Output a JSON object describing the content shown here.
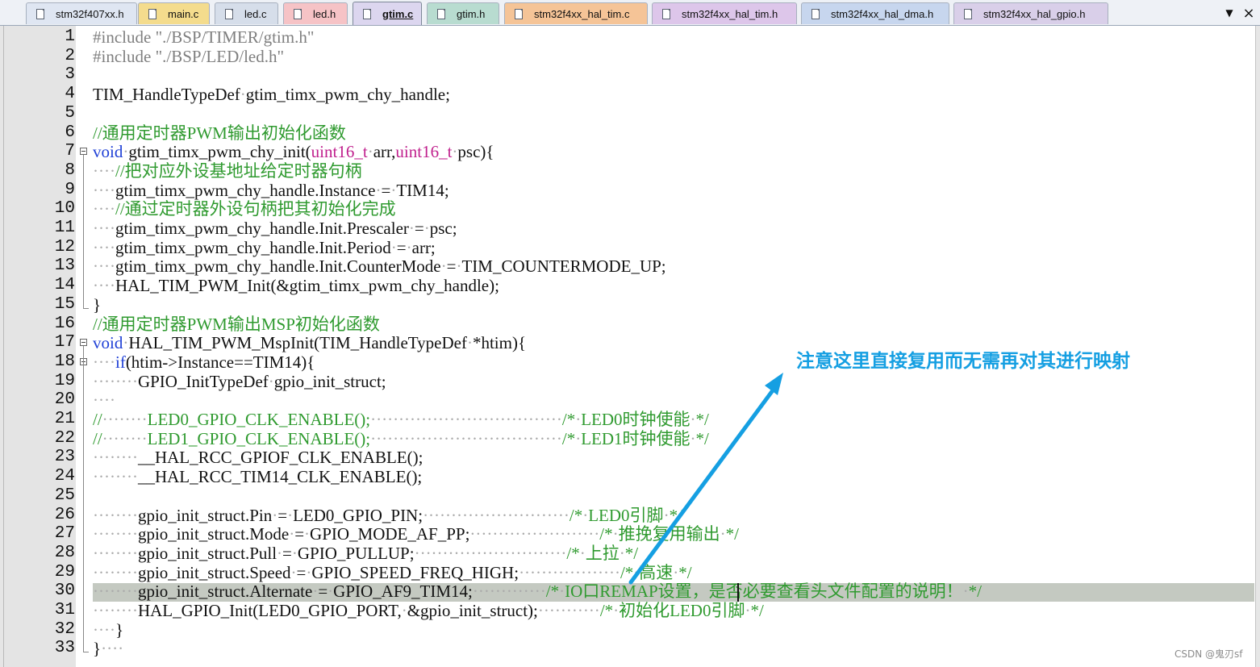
{
  "tabs": [
    {
      "label": "stm32f407xx.h",
      "color": "#dfe6f2",
      "active": false
    },
    {
      "label": "main.c",
      "color": "#f4dc8d",
      "active": false
    },
    {
      "label": "led.c",
      "color": "#d6deea",
      "active": false
    },
    {
      "label": "led.h",
      "color": "#f6c3c6",
      "active": false
    },
    {
      "label": "gtim.c",
      "color": "#dcd6ef",
      "active": true
    },
    {
      "label": "gtim.h",
      "color": "#b8dcd0",
      "active": false
    },
    {
      "label": "stm32f4xx_hal_tim.c",
      "color": "#f5c497",
      "active": false
    },
    {
      "label": "stm32f4xx_hal_tim.h",
      "color": "#ddc6ea",
      "active": false
    },
    {
      "label": "stm32f4xx_hal_dma.h",
      "color": "#c7d6ee",
      "active": false
    },
    {
      "label": "stm32f4xx_hal_gpio.h",
      "color": "#d9cfe9",
      "active": false
    }
  ],
  "tab_menu_glyph": "▼",
  "tab_close_glyph": "×",
  "line_numbers": [
    "1",
    "2",
    "3",
    "4",
    "5",
    "6",
    "7",
    "8",
    "9",
    "10",
    "11",
    "12",
    "13",
    "14",
    "15",
    "16",
    "17",
    "18",
    "19",
    "20",
    "21",
    "22",
    "23",
    "24",
    "25",
    "26",
    "27",
    "28",
    "29",
    "30",
    "31",
    "32",
    "33"
  ],
  "code": [
    [
      {
        "t": "#include ",
        "c": "c-pre"
      },
      {
        "t": "\"./BSP/TIMER/gtim.h\"",
        "c": "c-str"
      }
    ],
    [
      {
        "t": "#include ",
        "c": "c-pre"
      },
      {
        "t": "\"./BSP/LED/led.h\"",
        "c": "c-str"
      }
    ],
    [],
    [
      {
        "t": "TIM_HandleTypeDef",
        "c": ""
      },
      {
        "t": "·",
        "c": "c-dot"
      },
      {
        "t": "gtim_timx_pwm_chy_handle;",
        "c": ""
      }
    ],
    [],
    [
      {
        "t": "//通用定时器PWM输出初始化函数",
        "c": "c-com"
      }
    ],
    [
      {
        "t": "void",
        "c": "c-kw"
      },
      {
        "t": "·",
        "c": "c-dot"
      },
      {
        "t": "gtim_timx_pwm_chy_init(",
        "c": ""
      },
      {
        "t": "uint16_t",
        "c": "c-typ"
      },
      {
        "t": "·",
        "c": "c-dot"
      },
      {
        "t": "arr,",
        "c": ""
      },
      {
        "t": "uint16_t",
        "c": "c-typ"
      },
      {
        "t": "·",
        "c": "c-dot"
      },
      {
        "t": "psc){",
        "c": ""
      }
    ],
    [
      {
        "t": "····",
        "c": "c-dot"
      },
      {
        "t": "//把对应外设基地址给定时器句柄",
        "c": "c-com"
      }
    ],
    [
      {
        "t": "····",
        "c": "c-dot"
      },
      {
        "t": "gtim_timx_pwm_chy_handle.Instance",
        "c": ""
      },
      {
        "t": "·",
        "c": "c-dot"
      },
      {
        "t": "=",
        "c": ""
      },
      {
        "t": "·",
        "c": "c-dot"
      },
      {
        "t": "TIM14;",
        "c": ""
      }
    ],
    [
      {
        "t": "····",
        "c": "c-dot"
      },
      {
        "t": "//通过定时器外设句柄把其初始化完成",
        "c": "c-com"
      }
    ],
    [
      {
        "t": "····",
        "c": "c-dot"
      },
      {
        "t": "gtim_timx_pwm_chy_handle.Init.Prescaler",
        "c": ""
      },
      {
        "t": "·",
        "c": "c-dot"
      },
      {
        "t": "=",
        "c": ""
      },
      {
        "t": "·",
        "c": "c-dot"
      },
      {
        "t": "psc;",
        "c": ""
      }
    ],
    [
      {
        "t": "····",
        "c": "c-dot"
      },
      {
        "t": "gtim_timx_pwm_chy_handle.Init.Period",
        "c": ""
      },
      {
        "t": "·",
        "c": "c-dot"
      },
      {
        "t": "=",
        "c": ""
      },
      {
        "t": "·",
        "c": "c-dot"
      },
      {
        "t": "arr;",
        "c": ""
      }
    ],
    [
      {
        "t": "····",
        "c": "c-dot"
      },
      {
        "t": "gtim_timx_pwm_chy_handle.Init.CounterMode",
        "c": ""
      },
      {
        "t": "·",
        "c": "c-dot"
      },
      {
        "t": "=",
        "c": ""
      },
      {
        "t": "·",
        "c": "c-dot"
      },
      {
        "t": "TIM_COUNTERMODE_UP;",
        "c": ""
      }
    ],
    [
      {
        "t": "····",
        "c": "c-dot"
      },
      {
        "t": "HAL_TIM_PWM_Init(&gtim_timx_pwm_chy_handle);",
        "c": ""
      }
    ],
    [
      {
        "t": "}",
        "c": ""
      }
    ],
    [
      {
        "t": "//通用定时器PWM输出MSP初始化函数",
        "c": "c-com"
      }
    ],
    [
      {
        "t": "void",
        "c": "c-kw"
      },
      {
        "t": "·",
        "c": "c-dot"
      },
      {
        "t": "HAL_TIM_PWM_MspInit(TIM_HandleTypeDef",
        "c": ""
      },
      {
        "t": "·",
        "c": "c-dot"
      },
      {
        "t": "*htim){",
        "c": ""
      }
    ],
    [
      {
        "t": "····",
        "c": "c-dot"
      },
      {
        "t": "if",
        "c": "c-kw"
      },
      {
        "t": "(htim->Instance==TIM14){",
        "c": ""
      }
    ],
    [
      {
        "t": "········",
        "c": "c-dot"
      },
      {
        "t": "GPIO_InitTypeDef",
        "c": ""
      },
      {
        "t": "·",
        "c": "c-dot"
      },
      {
        "t": "gpio_init_struct;",
        "c": ""
      }
    ],
    [
      {
        "t": "····",
        "c": "c-dot"
      }
    ],
    [
      {
        "t": "//",
        "c": "c-com"
      },
      {
        "t": "········",
        "c": "c-dot"
      },
      {
        "t": "LED0_GPIO_CLK_ENABLE();",
        "c": "c-com"
      },
      {
        "t": "··································",
        "c": "c-dot"
      },
      {
        "t": "/*",
        "c": "c-com"
      },
      {
        "t": "·",
        "c": "c-dot"
      },
      {
        "t": "LED0时钟使能",
        "c": "c-com"
      },
      {
        "t": "·",
        "c": "c-dot"
      },
      {
        "t": "*/",
        "c": "c-com"
      }
    ],
    [
      {
        "t": "//",
        "c": "c-com"
      },
      {
        "t": "········",
        "c": "c-dot"
      },
      {
        "t": "LED1_GPIO_CLK_ENABLE();",
        "c": "c-com"
      },
      {
        "t": "··································",
        "c": "c-dot"
      },
      {
        "t": "/*",
        "c": "c-com"
      },
      {
        "t": "·",
        "c": "c-dot"
      },
      {
        "t": "LED1时钟使能",
        "c": "c-com"
      },
      {
        "t": "·",
        "c": "c-dot"
      },
      {
        "t": "*/",
        "c": "c-com"
      }
    ],
    [
      {
        "t": "········",
        "c": "c-dot"
      },
      {
        "t": "__HAL_RCC_GPIOF_CLK_ENABLE();",
        "c": ""
      }
    ],
    [
      {
        "t": "········",
        "c": "c-dot"
      },
      {
        "t": "__HAL_RCC_TIM14_CLK_ENABLE();",
        "c": ""
      }
    ],
    [],
    [
      {
        "t": "········",
        "c": "c-dot"
      },
      {
        "t": "gpio_init_struct.Pin",
        "c": ""
      },
      {
        "t": "·",
        "c": "c-dot"
      },
      {
        "t": "=",
        "c": ""
      },
      {
        "t": "·",
        "c": "c-dot"
      },
      {
        "t": "LED0_GPIO_PIN;",
        "c": ""
      },
      {
        "t": "··························",
        "c": "c-dot"
      },
      {
        "t": "/*",
        "c": "c-com"
      },
      {
        "t": "·",
        "c": "c-dot"
      },
      {
        "t": "LED0引脚",
        "c": "c-com"
      },
      {
        "t": "·",
        "c": "c-dot"
      },
      {
        "t": "*/",
        "c": "c-com"
      }
    ],
    [
      {
        "t": "········",
        "c": "c-dot"
      },
      {
        "t": "gpio_init_struct.Mode",
        "c": ""
      },
      {
        "t": "·",
        "c": "c-dot"
      },
      {
        "t": "=",
        "c": ""
      },
      {
        "t": "·",
        "c": "c-dot"
      },
      {
        "t": "GPIO_MODE_AF_PP;",
        "c": ""
      },
      {
        "t": "·······················",
        "c": "c-dot"
      },
      {
        "t": "/*",
        "c": "c-com"
      },
      {
        "t": "·",
        "c": "c-dot"
      },
      {
        "t": "推挽复用输出",
        "c": "c-com"
      },
      {
        "t": "·",
        "c": "c-dot"
      },
      {
        "t": "*/",
        "c": "c-com"
      }
    ],
    [
      {
        "t": "········",
        "c": "c-dot"
      },
      {
        "t": "gpio_init_struct.Pull",
        "c": ""
      },
      {
        "t": "·",
        "c": "c-dot"
      },
      {
        "t": "=",
        "c": ""
      },
      {
        "t": "·",
        "c": "c-dot"
      },
      {
        "t": "GPIO_PULLUP;",
        "c": ""
      },
      {
        "t": "···························",
        "c": "c-dot"
      },
      {
        "t": "/*",
        "c": "c-com"
      },
      {
        "t": "·",
        "c": "c-dot"
      },
      {
        "t": "上拉",
        "c": "c-com"
      },
      {
        "t": "·",
        "c": "c-dot"
      },
      {
        "t": "*/",
        "c": "c-com"
      }
    ],
    [
      {
        "t": "········",
        "c": "c-dot"
      },
      {
        "t": "gpio_init_struct.Speed",
        "c": ""
      },
      {
        "t": "·",
        "c": "c-dot"
      },
      {
        "t": "=",
        "c": ""
      },
      {
        "t": "·",
        "c": "c-dot"
      },
      {
        "t": "GPIO_SPEED_FREQ_HIGH;",
        "c": ""
      },
      {
        "t": "··················",
        "c": "c-dot"
      },
      {
        "t": "/*",
        "c": "c-com"
      },
      {
        "t": "·",
        "c": "c-dot"
      },
      {
        "t": "高速",
        "c": "c-com"
      },
      {
        "t": "·",
        "c": "c-dot"
      },
      {
        "t": "*/",
        "c": "c-com"
      }
    ],
    [
      {
        "t": "········",
        "c": "c-dot"
      },
      {
        "t": "gpio_init_struct.Alternate",
        "c": ""
      },
      {
        "t": "·",
        "c": "c-dot"
      },
      {
        "t": "=",
        "c": ""
      },
      {
        "t": "·",
        "c": "c-dot"
      },
      {
        "t": "GPIO_AF9_TIM14;",
        "c": ""
      },
      {
        "t": "·············",
        "c": "c-dot"
      },
      {
        "t": "/*",
        "c": "c-com"
      },
      {
        "t": "·",
        "c": "c-dot"
      },
      {
        "t": "IO口REMAP设置，是否必要查看头文件配置的说明！",
        "c": "c-com"
      },
      {
        "t": "·",
        "c": "c-dot"
      },
      {
        "t": "*/",
        "c": "c-com"
      }
    ],
    [
      {
        "t": "········",
        "c": "c-dot"
      },
      {
        "t": "HAL_GPIO_Init(LED0_GPIO_PORT,",
        "c": ""
      },
      {
        "t": "·",
        "c": "c-dot"
      },
      {
        "t": "&gpio_init_struct);",
        "c": ""
      },
      {
        "t": "···········",
        "c": "c-dot"
      },
      {
        "t": "/*",
        "c": "c-com"
      },
      {
        "t": "·",
        "c": "c-dot"
      },
      {
        "t": "初始化LED0引脚",
        "c": "c-com"
      },
      {
        "t": "·",
        "c": "c-dot"
      },
      {
        "t": "*/",
        "c": "c-com"
      }
    ],
    [
      {
        "t": "····",
        "c": "c-dot"
      },
      {
        "t": "}",
        "c": ""
      }
    ],
    [
      {
        "t": "}",
        "c": ""
      },
      {
        "t": "····",
        "c": "c-dot"
      }
    ]
  ],
  "annotation_text": "注意这里直接复用而无需再对其进行映射",
  "annotation_color": "#159fe2",
  "watermark": "CSDN @鬼刃sf"
}
